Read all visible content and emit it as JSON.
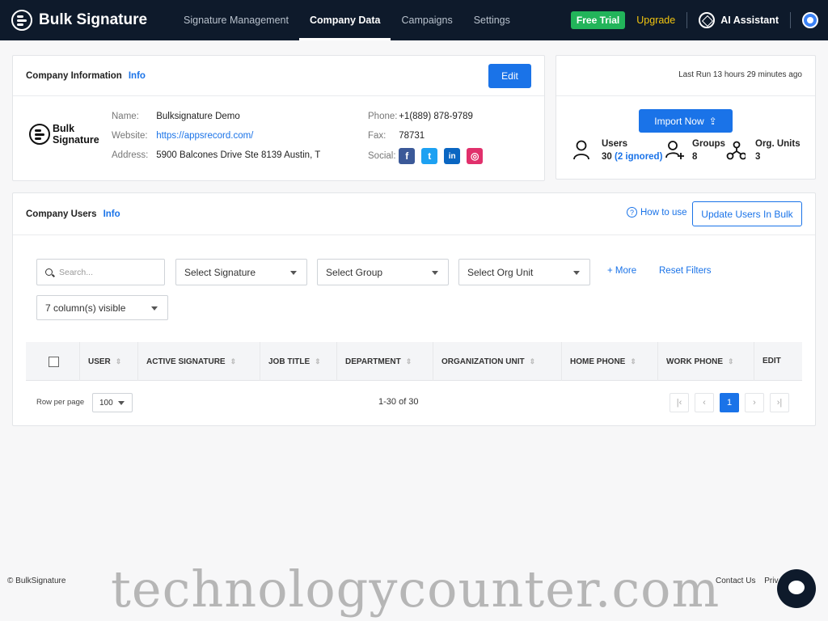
{
  "brand": {
    "name": "Bulk Signature"
  },
  "nav": {
    "tabs": [
      {
        "label": "Signature Management"
      },
      {
        "label": "Company Data"
      },
      {
        "label": "Campaigns"
      },
      {
        "label": "Settings"
      }
    ],
    "active_tab": "Company Data",
    "trial_badge": "Free Trial",
    "upgrade": "Upgrade",
    "ai_assistant": "AI Assistant"
  },
  "company": {
    "title": "Company Information",
    "info": "Info",
    "edit": "Edit",
    "logo_line1": "Bulk",
    "logo_line2": "Signature",
    "name_label": "Name:",
    "name_value": "Bulksignature Demo",
    "website_label": "Website:",
    "website_value": "https://appsrecord.com/",
    "address_label": "Address:",
    "address_value": "5900 Balcones Drive Ste 8139 Austin, T",
    "phone_label": "Phone:",
    "phone_value": "+1(889) 878-9789",
    "fax_label": "Fax:",
    "fax_value": "78731",
    "social_label": "Social:",
    "social": [
      {
        "icon": "facebook-icon",
        "glyph": "f",
        "color": "#3b5998"
      },
      {
        "icon": "twitter-icon",
        "glyph": "t",
        "color": "#1da1f2"
      },
      {
        "icon": "linkedin-icon",
        "glyph": "in",
        "color": "#0a66c2"
      },
      {
        "icon": "instagram-icon",
        "glyph": "◎",
        "color": "#e1306c"
      }
    ]
  },
  "stats": {
    "last_run": "Last Run 13 hours 29 minutes ago",
    "import_now": "Import Now",
    "users_label": "Users",
    "users_value": "30",
    "users_ignored": "(2 ignored)",
    "groups_label": "Groups",
    "groups_value": "8",
    "org_label": "Org. Units",
    "org_value": "3"
  },
  "users": {
    "title": "Company Users",
    "info": "Info",
    "how_to_use": "How to use",
    "update_bulk": "Update Users In Bulk",
    "search_placeholder": "Search...",
    "select_signature": "Select Signature",
    "select_group": "Select Group",
    "select_org": "Select Org Unit",
    "more": "+ More",
    "reset": "Reset Filters",
    "columns_visible": "7 column(s) visible",
    "columns": [
      "USER",
      "ACTIVE SIGNATURE",
      "JOB TITLE",
      "DEPARTMENT",
      "ORGANIZATION UNIT",
      "HOME PHONE",
      "WORK PHONE",
      "EDIT"
    ],
    "rows_per_page_label": "Row per page",
    "rows_per_page": "100",
    "range": "1-30 of 30",
    "current_page": "1"
  },
  "footer": {
    "copyright": "© BulkSignature",
    "contact": "Contact Us",
    "privacy": "Priv"
  },
  "watermark": "technologycounter.com"
}
